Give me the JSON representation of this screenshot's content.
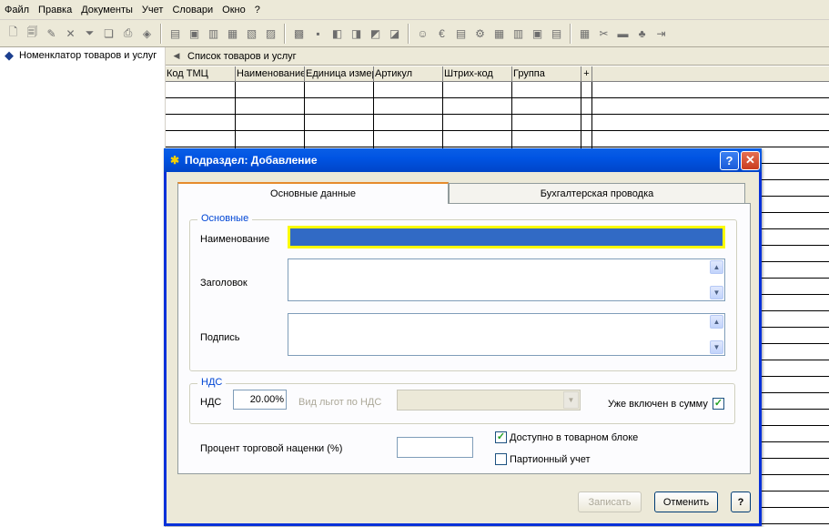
{
  "menu": [
    "Файл",
    "Правка",
    "Документы",
    "Учет",
    "Словари",
    "Окно",
    "?"
  ],
  "toolbar": {
    "group1": [
      "new-doc-icon",
      "copy-doc-icon",
      "edit-doc-icon",
      "delete-icon",
      "filter-icon",
      "tag-icon",
      "print-icon",
      "package-icon"
    ],
    "group2": [
      "folder-icon",
      "image-icon",
      "import-icon",
      "move-icon",
      "upload-icon",
      "export-icon"
    ],
    "group3": [
      "book-icon",
      "bookmark-icon",
      "link-icon",
      "chart-icon",
      "layers-icon",
      "document-icon"
    ],
    "group4": [
      "user-icon",
      "currency-icon",
      "notes-icon",
      "settings-icon",
      "group-icon",
      "table-icon",
      "archive-icon",
      "list-icon"
    ],
    "group5": [
      "calculator-icon",
      "tools-icon",
      "folder-open-icon",
      "transfer-icon",
      "exit-icon"
    ],
    "glyphs": {
      "group1": [
        "🗋",
        "🗐",
        "✎",
        "✕",
        "⏷",
        "❏",
        "⎙",
        "◈"
      ],
      "group2": [
        "▤",
        "▣",
        "▥",
        "▦",
        "▧",
        "▨"
      ],
      "group3": [
        "▩",
        "▪",
        "◧",
        "◨",
        "◩",
        "◪"
      ],
      "group4": [
        "☺",
        "€",
        "▤",
        "⚙",
        "▦",
        "▥",
        "▣",
        "▤"
      ],
      "group5": [
        "▦",
        "✂",
        "▬",
        "♣",
        "⇥"
      ]
    }
  },
  "tree": {
    "root_label": "Номенклатор товаров и услуг"
  },
  "list": {
    "title": "Список товаров и услуг",
    "columns": [
      "Код ТМЦ",
      "Наименование",
      "Единица измер",
      "Артикул",
      "Штрих-код",
      "Группа",
      "+"
    ]
  },
  "dialog": {
    "title": "Подраздел: Добавление",
    "help_label": "?",
    "close_label": "✕",
    "tabs": [
      "Основные данные",
      "Бухгалтерская проводка"
    ],
    "groups": {
      "main": {
        "title": "Основные",
        "name_label": "Наименование",
        "header_label": "Заголовок",
        "signature_label": "Подпись"
      },
      "vat": {
        "title": "НДС",
        "vat_label": "НДС",
        "vat_value": "20.00%",
        "benefit_label": "Вид льгот по НДС",
        "included_label": "Уже включен в сумму",
        "included_checked": true
      }
    },
    "markup_label": "Процент торговой наценки (%)",
    "markup_value": "",
    "available_label": "Доступно в товарном блоке",
    "available_checked": true,
    "batch_label": "Партионный учет",
    "batch_checked": false,
    "buttons": {
      "save": "Записать",
      "cancel": "Отменить",
      "help": "?"
    }
  }
}
